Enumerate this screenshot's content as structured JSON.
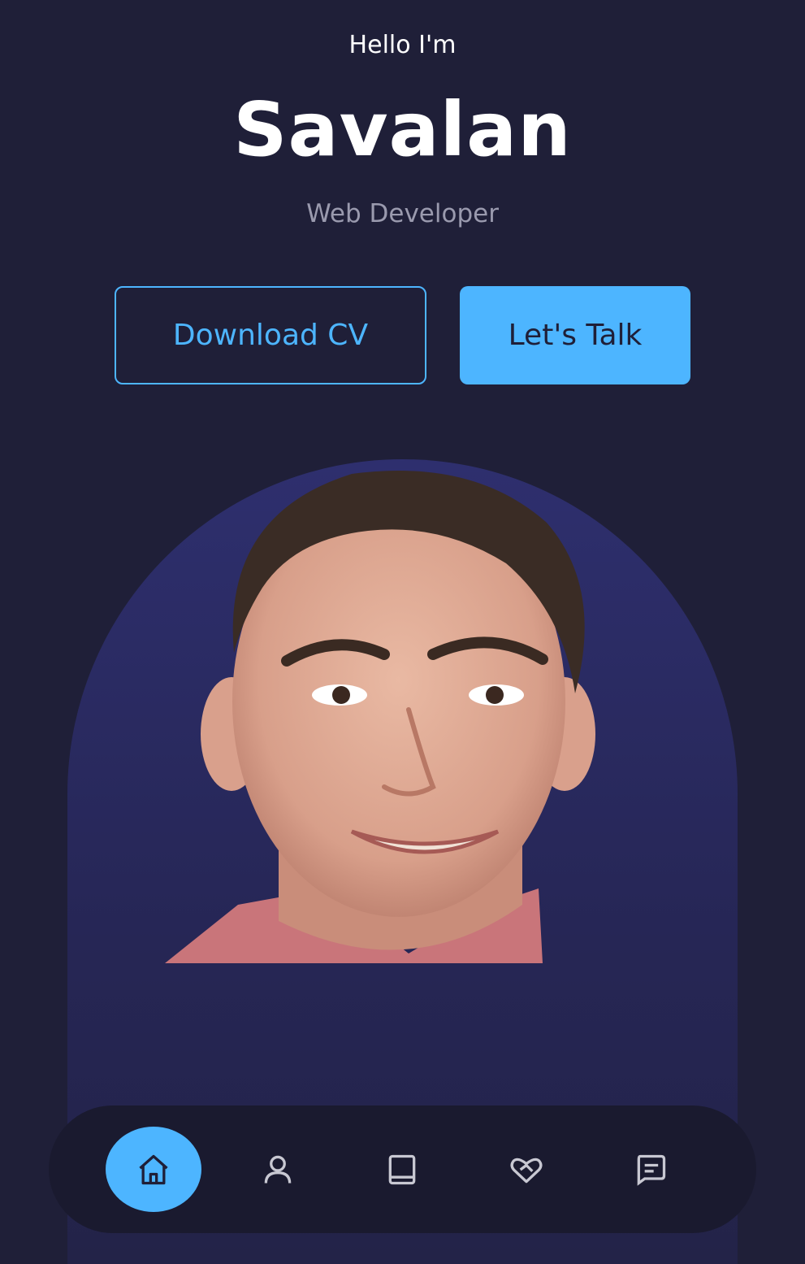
{
  "hero": {
    "greeting": "Hello I'm",
    "name": "Savalan",
    "role": "Web Developer"
  },
  "cta": {
    "download_label": "Download CV",
    "talk_label": "Let's Talk"
  },
  "nav": {
    "items": [
      {
        "icon": "home-icon",
        "active": true
      },
      {
        "icon": "user-icon",
        "active": false
      },
      {
        "icon": "book-icon",
        "active": false
      },
      {
        "icon": "handshake-icon",
        "active": false
      },
      {
        "icon": "message-icon",
        "active": false
      }
    ]
  },
  "colors": {
    "background": "#1f1f38",
    "primary": "#4db5ff",
    "text_light": "#9a9aae",
    "nav_bg": "#1a1a2f"
  }
}
